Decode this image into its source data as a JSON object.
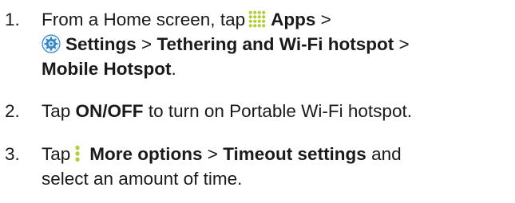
{
  "steps": [
    {
      "number": "1.",
      "text_a": "From a Home screen, tap",
      "apps_label": "Apps",
      "sep1": ">",
      "settings_label": "Settings",
      "sep2": ">",
      "tethering_label": "Tethering and Wi-Fi hotspot",
      "sep3": ">",
      "hotspot_label": "Mobile Hotspot",
      "end": "."
    },
    {
      "number": "2.",
      "text_a": "Tap",
      "onoff_label": "ON/OFF",
      "text_b": "to turn on Portable Wi-Fi hotspot."
    },
    {
      "number": "3.",
      "text_a": "Tap",
      "more_label": "More options",
      "sep1": ">",
      "timeout_label": "Timeout settings",
      "text_b": "and",
      "text_c": "select an amount of time."
    }
  ],
  "icons": {
    "apps": "apps-grid-icon",
    "settings": "settings-gear-icon",
    "more": "more-options-icon",
    "accent_color": "#b6ce3a",
    "settings_color": "#2f87c9"
  }
}
